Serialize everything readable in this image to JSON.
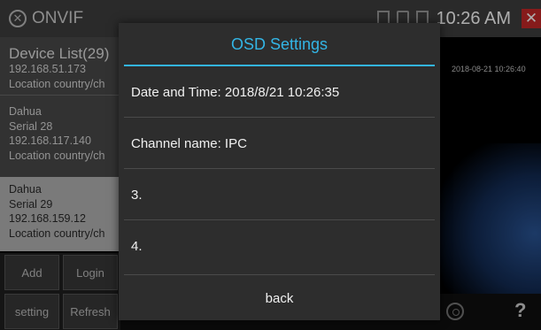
{
  "app": {
    "title": "ONVIF",
    "clock": "10:26 AM",
    "close_glyph": "✕"
  },
  "device_list": {
    "title": "Device List(29)",
    "items": [
      {
        "lines": [
          "192.168.51.173",
          "Location country/ch"
        ],
        "selected": false
      },
      {
        "lines": [
          "Dahua",
          "Serial 28",
          "192.168.117.140",
          "Location country/ch"
        ],
        "selected": false
      },
      {
        "lines": [
          "Dahua",
          "Serial 29",
          "192.168.159.12",
          "Location country/ch"
        ],
        "selected": true
      }
    ]
  },
  "buttons": {
    "add": "Add",
    "login": "Login",
    "setting": "setting",
    "refresh": "Refresh"
  },
  "video": {
    "timestamp": "2018-08-21 10:26:40"
  },
  "dialog": {
    "title": "OSD Settings",
    "rows": [
      "Date and Time: 2018/8/21 10:26:35",
      "Channel name: IPC",
      "3.",
      "4."
    ],
    "back_label": "back"
  },
  "colors": {
    "accent": "#33b5e5",
    "dialog_bg": "#2d2d2d",
    "close": "#c62828"
  },
  "icons": [
    "onvif-icon",
    "storage-icon",
    "wifi-icon",
    "battery-icon",
    "close-icon",
    "disc-icon",
    "help-icon"
  ]
}
